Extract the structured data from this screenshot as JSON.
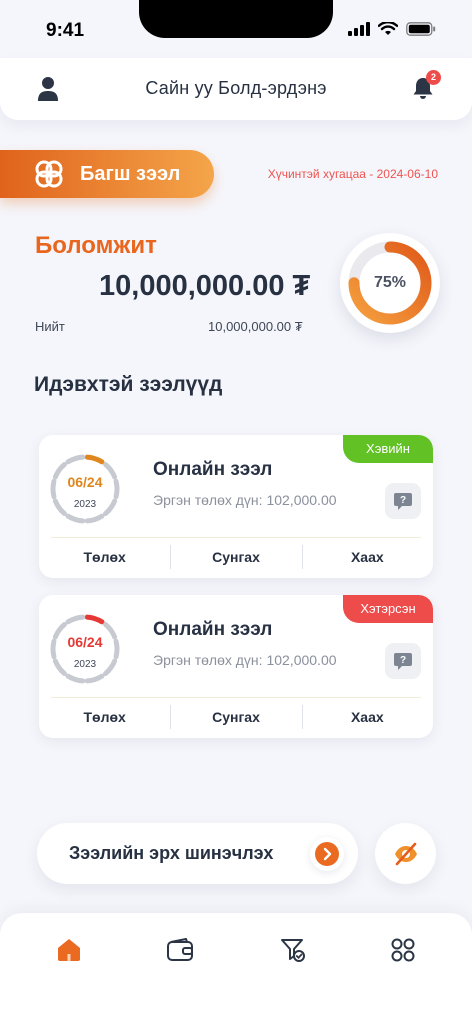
{
  "status_bar": {
    "time": "9:41"
  },
  "header": {
    "greeting": "Сайн уу Болд-эрдэнэ",
    "notification_count": "2"
  },
  "loan_product": {
    "name": "Багш зээл",
    "expiry": "Хүчинтэй хугацаа - 2024-06-10"
  },
  "summary": {
    "available_label": "Боломжит",
    "available_amount": "10,000,000.00 ₮",
    "total_label": "Нийт",
    "total_amount": "10,000,000.00 ₮",
    "progress_text": "75%",
    "progress_value": 0.75,
    "accent_color": "#e9661f"
  },
  "active_loans": {
    "title": "Идэвхтэй зээлүүд",
    "items": [
      {
        "status": "Хэвийн",
        "status_color": "#62c124",
        "date": "06/24",
        "year": "2023",
        "title": "Онлайн зээл",
        "repayment": "Эргэн төлөх дүн: 102,000.00",
        "date_color": "#e0861f",
        "actions": {
          "pay": "Төлөх",
          "extend": "Сунгах",
          "close": "Хаах"
        }
      },
      {
        "status": "Хэтэрсэн",
        "status_color": "#ee4b4b",
        "date": "06/24",
        "year": "2023",
        "title": "Онлайн зээл",
        "repayment": "Эргэн төлөх дүн: 102,000.00",
        "date_color": "#e53935",
        "actions": {
          "pay": "Төлөх",
          "extend": "Сунгах",
          "close": "Хаах"
        }
      }
    ]
  },
  "renew": {
    "label": "Зээлийн эрх шинэчлэх"
  },
  "bottom_nav": {
    "items": [
      "home-icon",
      "wallet-icon",
      "filter-icon",
      "grid-icon"
    ]
  }
}
